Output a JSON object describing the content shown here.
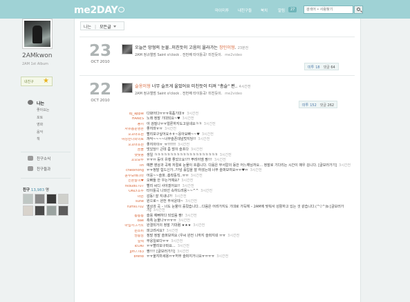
{
  "topbar": {
    "logo": "me2DAY",
    "nav": [
      "마이미투",
      "내친구들",
      "북치",
      "알림"
    ],
    "notif_count": "27",
    "search_placeholder": "검색어 • 사람찾기",
    "bg_color": "#9fd2d5"
  },
  "profile": {
    "name": "2AMkwon",
    "subtitle": "2AM 1st Album",
    "fav_label": "내친구"
  },
  "left_menu": {
    "me_label": "나는",
    "sub_items": [
      "좋아요는",
      "포토",
      "영화",
      "음악",
      "책"
    ],
    "friend_news": "친구소식",
    "friend_group": "친구들과",
    "friends_title": "친구",
    "friends_count": "13,983",
    "friends_unit": "명",
    "friend_colors": [
      "#bfc7c4",
      "#8a8a8a",
      "#3a3a3a",
      "#cfd0cb",
      "#d8d3cc",
      "#4a4a4a",
      "#9aa3a0",
      "#5c5c5c"
    ]
  },
  "breadcrumb": {
    "root": "나는",
    "current": "모든글"
  },
  "posts": [
    {
      "day": "23",
      "month": "OCT 2010",
      "title_pre": "오늘은 망형의 눈물..미친듯이 고음이 올라가는 ",
      "title_hl": "창민이형",
      "title_post": ".",
      "ago": "23분전",
      "meta": "2AM 정규앨범 Saint o'clock . 전번째 타이틀곡! 미친듯이.",
      "source": "me2video",
      "metoo_label": "미투",
      "metoo": "18",
      "comments_label": "댓글",
      "comments": "64"
    },
    {
      "day": "22",
      "month": "OCT 2010",
      "title_pre": "",
      "title_hl": "슬옹이형",
      "title_post": " 너무 슬프게 울었어요 미친듯이 티져 \"총슬\" 편..",
      "ago": "4시간전",
      "meta": "2AM 정규앨범 Saint o'clock . 전번째 타이틀곡! 미친듯이.",
      "source": "me2video",
      "metoo_label": "미투",
      "metoo": "152",
      "comments_label": "댓글",
      "comments": "262"
    }
  ],
  "comments": [
    {
      "name": "bj_apple",
      "text": "다봐어다ㅠㅠㅠ목품기대ㅎ",
      "time": "3시간전"
    },
    {
      "name": "HANES",
      "text": "노래 정말 기대되요~♥",
      "time": "3시간전"
    },
    {
      "name": "동이",
      "text": "아 검질나ㅠㅠ얼론하지도고실네요ㅋㅋ",
      "time": "3시간전"
    },
    {
      "name": "자유롭운영혼",
      "text": "좋지마ㅠㅠ",
      "time": "3시간전"
    },
    {
      "name": "꼬꼬마초원",
      "text": "빨리보구싶어요ㅎㅎ~응아요빠~~♥",
      "time": "3시간전"
    },
    {
      "name": "여성한나와의로",
      "text": "꺄악~~~~너무슬픈데넘멋지당!!",
      "time": "3시간전"
    },
    {
      "name": "꼬꼬마초원",
      "text": "좋지아이ㅠ_ㅠ!!!!!!",
      "time": "3시간전"
    },
    {
      "name": "곰돌",
      "text": "멋있당!! 근데 좀 많이 슬프다",
      "time": "3시간전"
    },
    {
      "name": "햇빛용",
      "text": "생일 ㅋㅋㅋㅋㅋㅋㅋㅋㅋㅋㅋㅋㅋㅋㅋㅋㅋㅋㅋㅋ",
      "time": "3시간전"
    },
    {
      "name": "꼬꼬보루",
      "text": "ㅠㅠㅠ 등이 유행 좋았으요!?? 뿌려어엠 짱!!!",
      "time": "3시간전"
    },
    {
      "name": "lin",
      "text": "예쁜 영상과 곡에 저절로 눈물이 흐릅니다. 다음은 무서칼의 동안 어느해님까요… 정말로 기다리는 시간이 매우 김니다. [글보러가기]",
      "time": "3시간전"
    },
    {
      "name": "cheolhong",
      "text": "ㅠㅠ정말 힘드신가..??넘 훌입을 잘 하셨는데 너무 슬퍼보여요ㅠㅠ♥ㅠ",
      "time": "3시간전"
    },
    {
      "name": "윤수보배나라",
      "text": "어응~~슬파..흥착뚱칙..ㅠㅠ",
      "time": "3시간전"
    },
    {
      "name": "친론말이♥",
      "text": "오빠들 안 우는거예요?",
      "time": "3시간전"
    },
    {
      "name": "rkdud0707",
      "text": "빨리 씨디 사야겠어요!!",
      "time": "3시간전"
    },
    {
      "name": "ONLY조두",
      "text": "타이틀곡 나와선 속하드려용~~^^",
      "time": "3시간전"
    },
    {
      "name": "마은",
      "text": "감동! 잘 지내냐?!",
      "time": "3시간전"
    },
    {
      "name": "sune",
      "text": "원으로~ 완전 무서운데~",
      "time": "3시간전"
    },
    {
      "name": "rumi0702",
      "text": "영상과 곡 – 너도 눈물이 흘렀습니다…다음은 어려가지도 기대로 가득해 – 2AM에 맞춰서 성활하고 있는 것 같습니다.(^▽^)b [글보러가기]",
      "time": "3시간전"
    },
    {
      "name": "통통통",
      "text": "슬옹 예뻐하다 되었음 짱!",
      "time": "3시간전"
    },
    {
      "name": "dae",
      "text": "흑흑 눈물나ㅠㅠㅠㅠ",
      "time": "3시간전"
    },
    {
      "name": "마법사그거노",
      "text": "완결되거의 정말 기대렴 ★★★",
      "time": "3시간전"
    },
    {
      "name": "원소비",
      "text": "파고려서요?",
      "time": "3시간전"
    },
    {
      "name": "명통남",
      "text": "정말 정말 슬퍼보여요 (우씨 완전 나까지 슬퍼지네 ㅠㅠ",
      "time": "3시간전"
    },
    {
      "name": "일렉",
      "text": "무응일로다ㅠㅠ",
      "time": "3시간전"
    },
    {
      "name": "IEUNI",
      "text": "ㅠㅠ빨리보구파요…",
      "time": "3시간전"
    },
    {
      "name": "jjm7783",
      "text": "짱!!!! [글보러가기]",
      "time": "3시간전"
    },
    {
      "name": "breflb",
      "text": "ㅠㅠ울지마세용ㅠㅠ허무 슬퍼지거나요ㅠㅠㅠㅠ",
      "time": "3시간전"
    }
  ]
}
